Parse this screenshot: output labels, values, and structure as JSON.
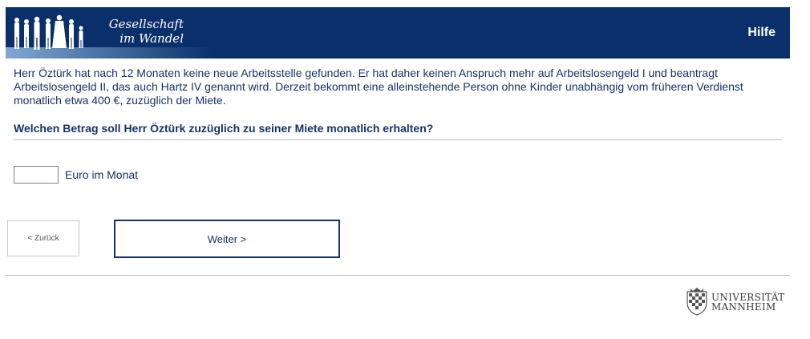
{
  "header": {
    "logo_line1": "Gesellschaft",
    "logo_line2": "im Wandel",
    "help_label": "Hilfe",
    "colors": {
      "bar": "#0a2f6a",
      "text": "#ffffff"
    }
  },
  "main": {
    "intro": "Herr Öztürk hat nach 12 Monaten keine neue Arbeitsstelle gefunden. Er hat daher keinen Anspruch mehr auf Arbeitslosengeld I und beantragt Arbeitslosengeld II, das auch Hartz IV genannt wird. Derzeit bekommt eine alleinstehende Person ohne Kinder unabhängig vom früheren Verdienst monatlich etwa 400 €, zuzüglich der Miete.",
    "question": "Welchen Betrag soll Herr Öztürk zuzüglich zu seiner Miete monatlich erhalten?",
    "amount_value": "",
    "amount_unit": "Euro im Monat"
  },
  "nav": {
    "back_label": "< Zurück",
    "next_label": "Weiter >"
  },
  "footer": {
    "uni_line1": "UNIVERSITÄT",
    "uni_line2": "MANNHEIM",
    "crest_icon": "university-crest-icon"
  }
}
